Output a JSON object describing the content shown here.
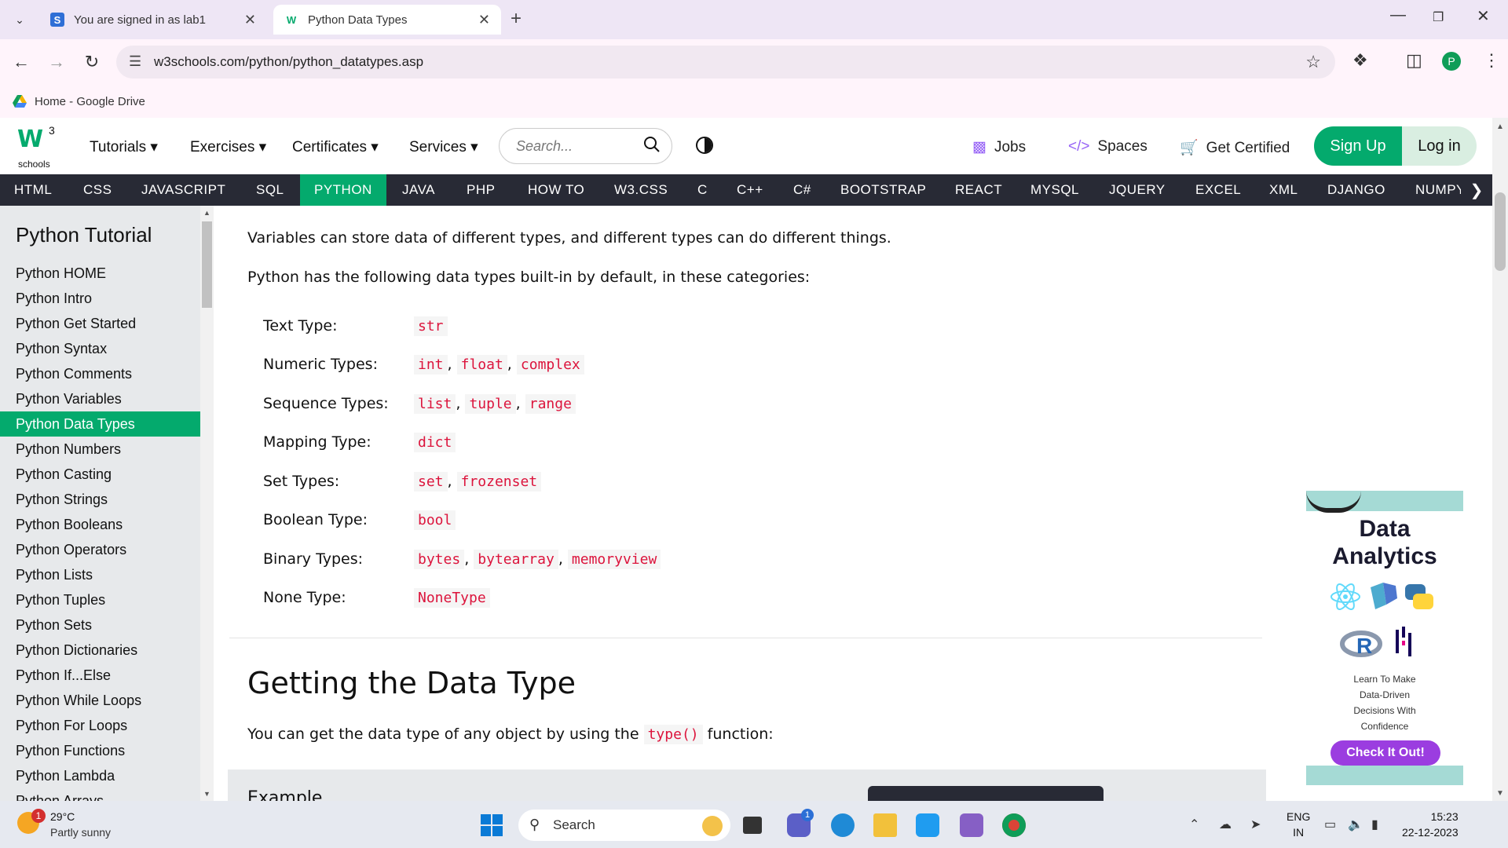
{
  "browser": {
    "tabs": [
      {
        "title": "You are signed in as lab1",
        "favicon": "S"
      },
      {
        "title": "Python Data Types",
        "favicon": "W"
      }
    ],
    "url": "w3schools.com/python/python_datatypes.asp",
    "profile_initial": "P",
    "bookmark": "Home - Google Drive"
  },
  "header": {
    "logo_sup": "3",
    "logo_text": "schools",
    "menu": [
      "Tutorials",
      "Exercises",
      "Certificates",
      "Services"
    ],
    "search_placeholder": "Search...",
    "links": [
      {
        "label": "Jobs",
        "icon": "briefcase-icon"
      },
      {
        "label": "Spaces",
        "icon": "code-icon"
      },
      {
        "label": "Get Certified",
        "icon": "cart-icon"
      }
    ],
    "sign_up": "Sign Up",
    "log_in": "Log in"
  },
  "topnav": [
    "HTML",
    "CSS",
    "JAVASCRIPT",
    "SQL",
    "PYTHON",
    "JAVA",
    "PHP",
    "HOW TO",
    "W3.CSS",
    "C",
    "C++",
    "C#",
    "BOOTSTRAP",
    "REACT",
    "MYSQL",
    "JQUERY",
    "EXCEL",
    "XML",
    "DJANGO",
    "NUMPY"
  ],
  "sidebar": {
    "title": "Python Tutorial",
    "items": [
      "Python HOME",
      "Python Intro",
      "Python Get Started",
      "Python Syntax",
      "Python Comments",
      "Python Variables",
      "Python Data Types",
      "Python Numbers",
      "Python Casting",
      "Python Strings",
      "Python Booleans",
      "Python Operators",
      "Python Lists",
      "Python Tuples",
      "Python Sets",
      "Python Dictionaries",
      "Python If...Else",
      "Python While Loops",
      "Python For Loops",
      "Python Functions",
      "Python Lambda",
      "Python Arrays"
    ],
    "active": "Python Data Types"
  },
  "main": {
    "para1": "Variables can store data of different types, and different types can do different things.",
    "para2": "Python has the following data types built-in by default, in these categories:",
    "types": [
      {
        "label": "Text Type:",
        "values": [
          "str"
        ]
      },
      {
        "label": "Numeric Types:",
        "values": [
          "int",
          "float",
          "complex"
        ]
      },
      {
        "label": "Sequence Types:",
        "values": [
          "list",
          "tuple",
          "range"
        ]
      },
      {
        "label": "Mapping Type:",
        "values": [
          "dict"
        ]
      },
      {
        "label": "Set Types:",
        "values": [
          "set",
          "frozenset"
        ]
      },
      {
        "label": "Boolean Type:",
        "values": [
          "bool"
        ]
      },
      {
        "label": "Binary Types:",
        "values": [
          "bytes",
          "bytearray",
          "memoryview"
        ]
      },
      {
        "label": "None Type:",
        "values": [
          "NoneType"
        ]
      }
    ],
    "heading": "Getting the Data Type",
    "para3_before": "You can get the data type of any object by using the",
    "para3_code": "type()",
    "para3_after": "function:",
    "example_label": "Example"
  },
  "ad": {
    "title1": "Data",
    "title2": "Analytics",
    "line1": "Learn To Make",
    "line2": "Data-Driven",
    "line3": "Decisions With",
    "line4": "Confidence",
    "cta": "Check It Out!"
  },
  "taskbar": {
    "temp": "29°C",
    "condition": "Partly sunny",
    "weather_badge": "1",
    "search": "Search",
    "chat_badge": "1",
    "lang1": "ENG",
    "lang2": "IN",
    "time": "15:23",
    "date": "22-12-2023"
  }
}
